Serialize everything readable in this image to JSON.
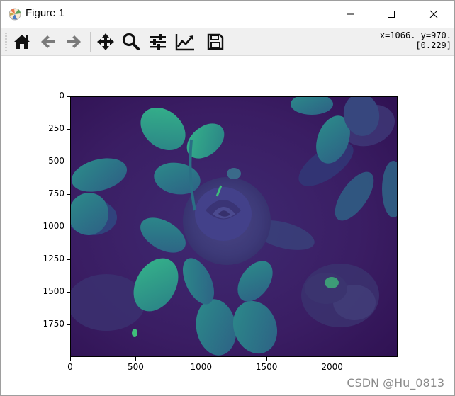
{
  "window": {
    "title": "Figure 1",
    "controls": {
      "minimize": "minimize",
      "maximize": "maximize",
      "close": "close"
    }
  },
  "toolbar": {
    "buttons": [
      {
        "name": "home",
        "icon": "home-icon"
      },
      {
        "name": "back",
        "icon": "arrow-left-icon"
      },
      {
        "name": "forward",
        "icon": "arrow-right-icon"
      },
      {
        "name": "pan",
        "icon": "move-icon"
      },
      {
        "name": "zoom",
        "icon": "magnifier-icon"
      },
      {
        "name": "configure-subplots",
        "icon": "sliders-icon"
      },
      {
        "name": "edit-axis",
        "icon": "line-chart-icon"
      },
      {
        "name": "save",
        "icon": "floppy-disk-icon"
      }
    ],
    "coords_line1": "x=1066. y=970.",
    "coords_line2": "[0.229]"
  },
  "plot": {
    "y_ticks": [
      {
        "label": "0",
        "value": 0
      },
      {
        "label": "250",
        "value": 250
      },
      {
        "label": "500",
        "value": 500
      },
      {
        "label": "750",
        "value": 750
      },
      {
        "label": "1000",
        "value": 1000
      },
      {
        "label": "1250",
        "value": 1250
      },
      {
        "label": "1500",
        "value": 1500
      },
      {
        "label": "1750",
        "value": 1750
      }
    ],
    "x_ticks": [
      {
        "label": "0",
        "value": 0
      },
      {
        "label": "500",
        "value": 500
      },
      {
        "label": "1000",
        "value": 1000
      },
      {
        "label": "1500",
        "value": 1500
      },
      {
        "label": "2000",
        "value": 2000
      }
    ],
    "x_range": [
      0,
      2500
    ],
    "y_range": [
      0,
      2000
    ],
    "colormap": "viridis",
    "colors": {
      "background": "#3b1b5e",
      "leaf": "#2f8f86",
      "leaf_bright": "#3fbf7a",
      "rose": "#3d3a78"
    }
  },
  "watermark": "CSDN @Hu_0813"
}
